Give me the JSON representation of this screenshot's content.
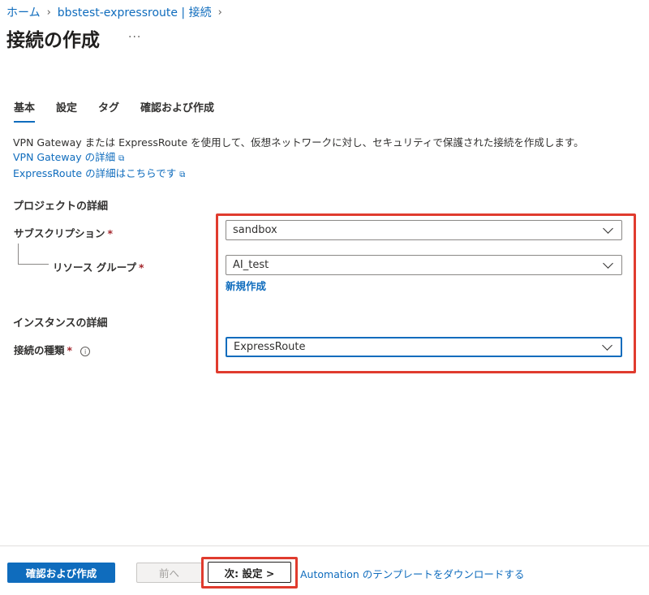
{
  "breadcrumb": {
    "home": "ホーム",
    "resource": "bbstest-expressroute | 接続"
  },
  "page": {
    "title": "接続の作成",
    "more": "···"
  },
  "tabs": [
    {
      "label": "基本"
    },
    {
      "label": "設定"
    },
    {
      "label": "タグ"
    },
    {
      "label": "確認および作成"
    }
  ],
  "intro": {
    "description": "VPN Gateway または ExpressRoute を使用して、仮想ネットワークに対し、セキュリティで保護された接続を作成します。",
    "link_vpn": "VPN Gateway の詳細",
    "link_er": "ExpressRoute の詳細はこちらです"
  },
  "project": {
    "heading": "プロジェクトの詳細",
    "subscription_label": "サブスクリプション",
    "subscription_value": "sandbox",
    "rg_label": "リソース グループ",
    "rg_value": "AI_test",
    "new_link": "新規作成"
  },
  "instance": {
    "heading": "インスタンスの詳細",
    "type_label": "接続の種類",
    "type_value": "ExpressRoute"
  },
  "required_mark": "*",
  "footer": {
    "review_create": "確認および作成",
    "previous": "前へ",
    "next": "次: 設定 >",
    "download": "Automation のテンプレートをダウンロードする"
  },
  "colors": {
    "accent": "#0f6cbd",
    "highlight": "#e03b2e"
  }
}
